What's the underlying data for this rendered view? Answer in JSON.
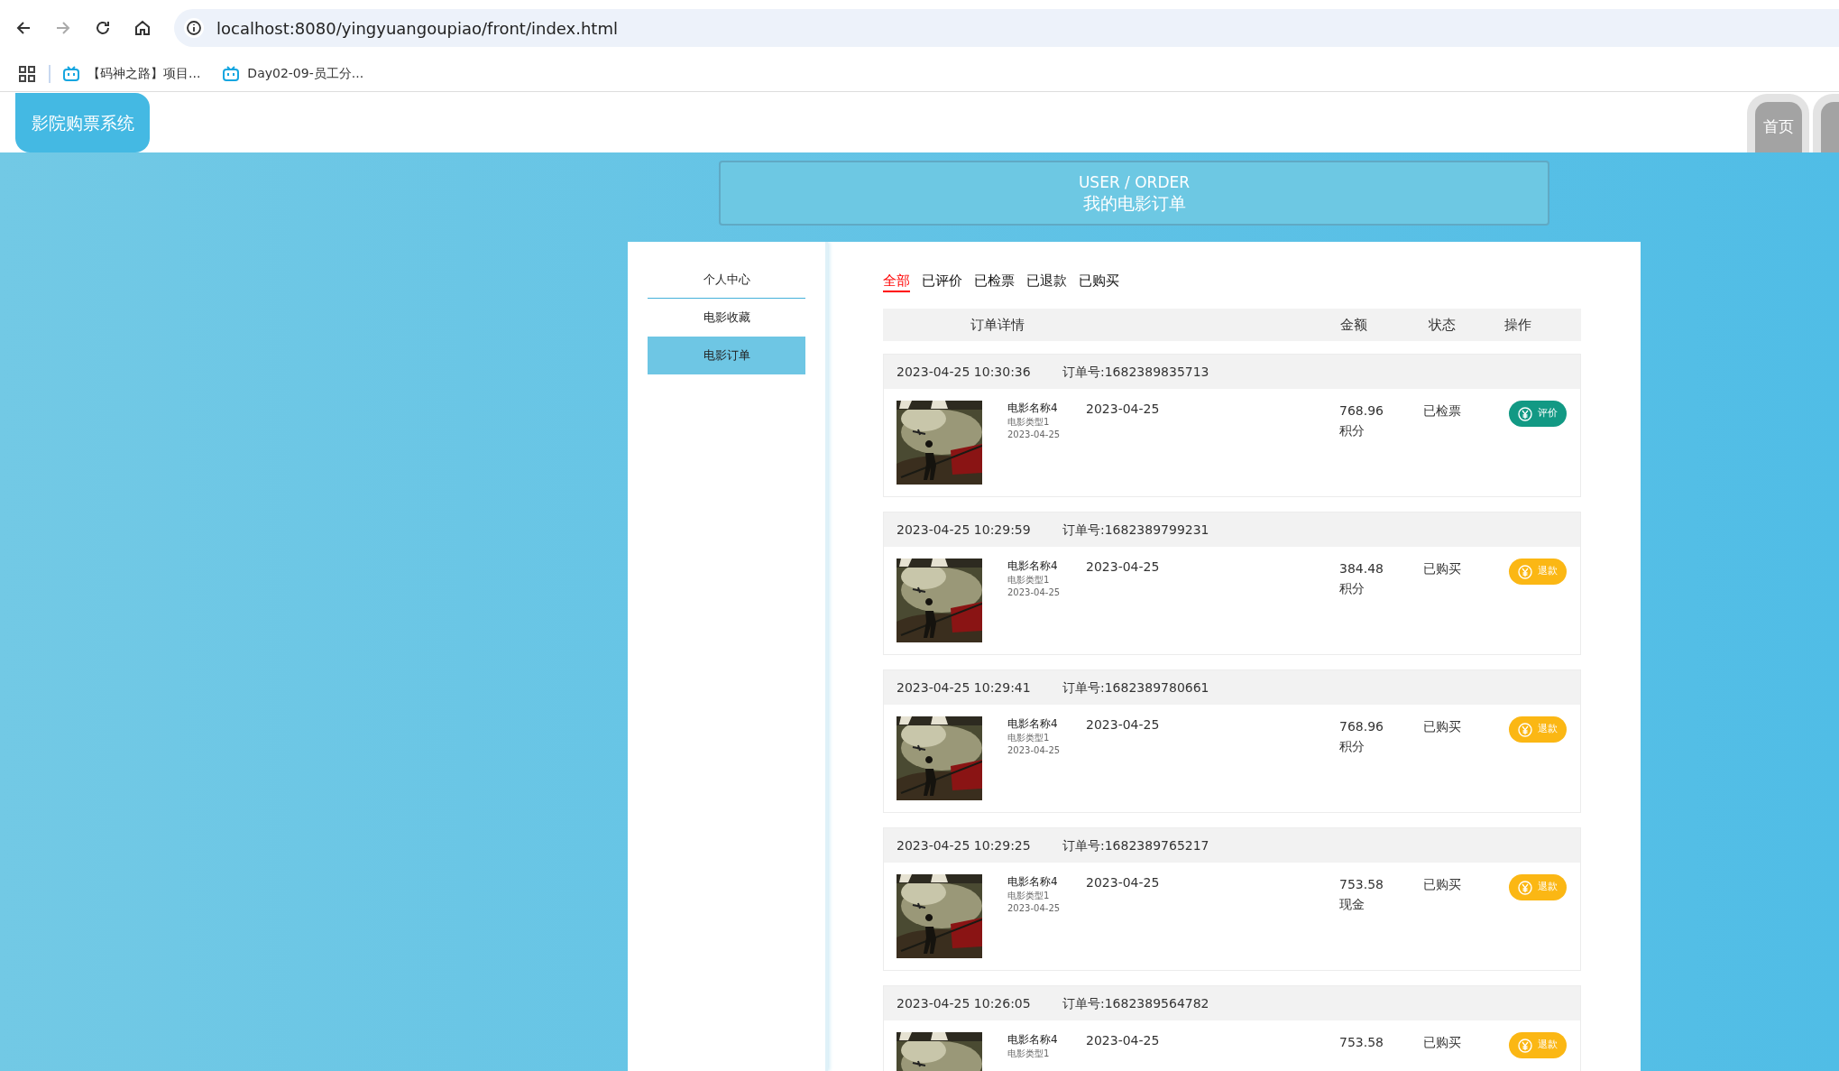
{
  "browser": {
    "url": "localhost:8080/yingyuangoupiao/front/index.html",
    "bookmarks": [
      {
        "label": "【码神之路】项目..."
      },
      {
        "label": "Day02-09-员工分..."
      }
    ]
  },
  "header": {
    "logo": "影院购票系统",
    "nav": [
      {
        "label": "首页"
      }
    ]
  },
  "banner": {
    "subtitle": "USER / ORDER",
    "title": "我的电影订单"
  },
  "sidebar": {
    "items": [
      {
        "label": "个人中心",
        "selected": false
      },
      {
        "label": "电影收藏",
        "selected": false
      },
      {
        "label": "电影订单",
        "selected": true
      }
    ]
  },
  "filter_tabs": [
    {
      "label": "全部",
      "selected": true
    },
    {
      "label": "已评价",
      "selected": false
    },
    {
      "label": "已检票",
      "selected": false
    },
    {
      "label": "已退款",
      "selected": false
    },
    {
      "label": "已购买",
      "selected": false
    }
  ],
  "table": {
    "columns": [
      "订单详情",
      "金额",
      "状态",
      "操作"
    ]
  },
  "orders": [
    {
      "time": "2023-04-25 10:30:36",
      "order_no": "订单号:1682389835713",
      "movie_name": "电影名称4",
      "movie_type": "电影类型1",
      "release_date": "2023-04-25",
      "show_date": "2023-04-25",
      "amount": "768.96",
      "payment": "积分",
      "status": "已检票",
      "action": {
        "kind": "review",
        "label": "评价"
      }
    },
    {
      "time": "2023-04-25 10:29:59",
      "order_no": "订单号:1682389799231",
      "movie_name": "电影名称4",
      "movie_type": "电影类型1",
      "release_date": "2023-04-25",
      "show_date": "2023-04-25",
      "amount": "384.48",
      "payment": "积分",
      "status": "已购买",
      "action": {
        "kind": "refund",
        "label": "退款"
      }
    },
    {
      "time": "2023-04-25 10:29:41",
      "order_no": "订单号:1682389780661",
      "movie_name": "电影名称4",
      "movie_type": "电影类型1",
      "release_date": "2023-04-25",
      "show_date": "2023-04-25",
      "amount": "768.96",
      "payment": "积分",
      "status": "已购买",
      "action": {
        "kind": "refund",
        "label": "退款"
      }
    },
    {
      "time": "2023-04-25 10:29:25",
      "order_no": "订单号:1682389765217",
      "movie_name": "电影名称4",
      "movie_type": "电影类型1",
      "release_date": "2023-04-25",
      "show_date": "2023-04-25",
      "amount": "753.58",
      "payment": "现金",
      "status": "已购买",
      "action": {
        "kind": "refund",
        "label": "退款"
      }
    },
    {
      "time": "2023-04-25 10:26:05",
      "order_no": "订单号:1682389564782",
      "movie_name": "电影名称4",
      "movie_type": "电影类型1",
      "show_date": "2023-04-25",
      "amount": "753.58",
      "status": "已购买",
      "action": {
        "kind": "refund",
        "label": "退款"
      }
    }
  ]
}
